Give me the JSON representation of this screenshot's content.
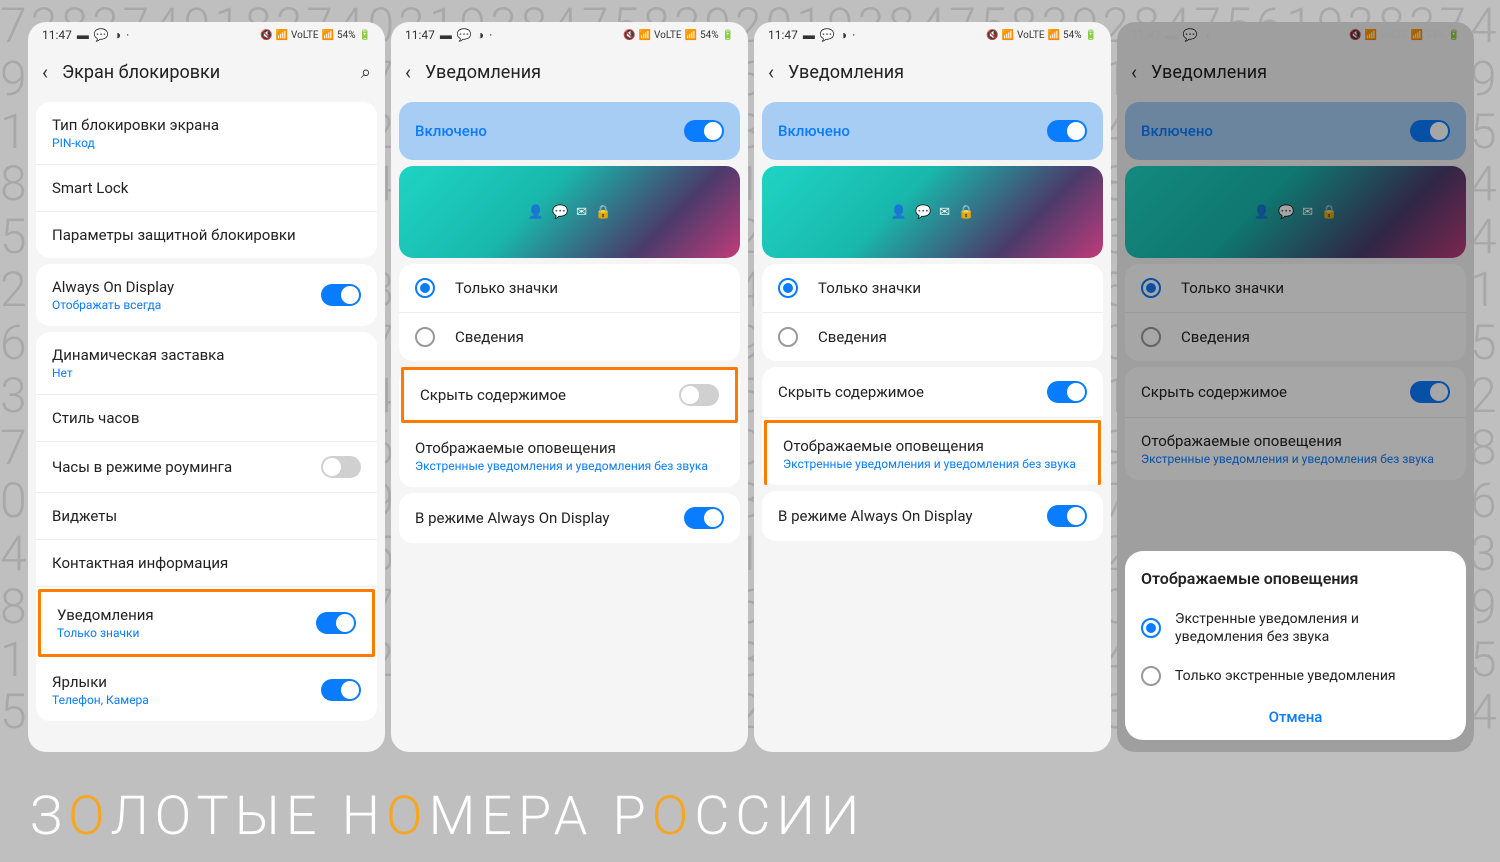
{
  "status": {
    "time": "11:47",
    "battery": "54%"
  },
  "screen1": {
    "title": "Экран блокировки",
    "items": [
      {
        "title": "Тип блокировки экрана",
        "sub": "PIN-код"
      },
      {
        "title": "Smart Lock"
      },
      {
        "title": "Параметры защитной блокировки"
      }
    ],
    "aod": {
      "title": "Always On Display",
      "sub": "Отображать всегда"
    },
    "items2": [
      {
        "title": "Динамическая заставка",
        "sub": "Нет"
      },
      {
        "title": "Стиль часов"
      },
      {
        "title": "Часы в режиме роуминга"
      },
      {
        "title": "Виджеты"
      },
      {
        "title": "Контактная информация"
      },
      {
        "title": "Уведомления",
        "sub": "Только значки"
      },
      {
        "title": "Ярлыки",
        "sub": "Телефон, Камера"
      }
    ]
  },
  "notif": {
    "title": "Уведомления",
    "enabled": "Включено",
    "radios": [
      "Только значки",
      "Сведения"
    ],
    "hide": "Скрыть содержимое",
    "shown": {
      "title": "Отображаемые оповещения",
      "sub": "Экстренные уведомления и уведомления без звука"
    },
    "aod": "В режиме Always On Display"
  },
  "dialog": {
    "title": "Отображаемые оповещения",
    "opt1": "Экстренные уведомления и уведомления без звука",
    "opt2": "Только экстренные уведомления",
    "cancel": "Отмена"
  },
  "footer": "ЗОЛОТЫЕ НОМЕРА РОССИИ"
}
